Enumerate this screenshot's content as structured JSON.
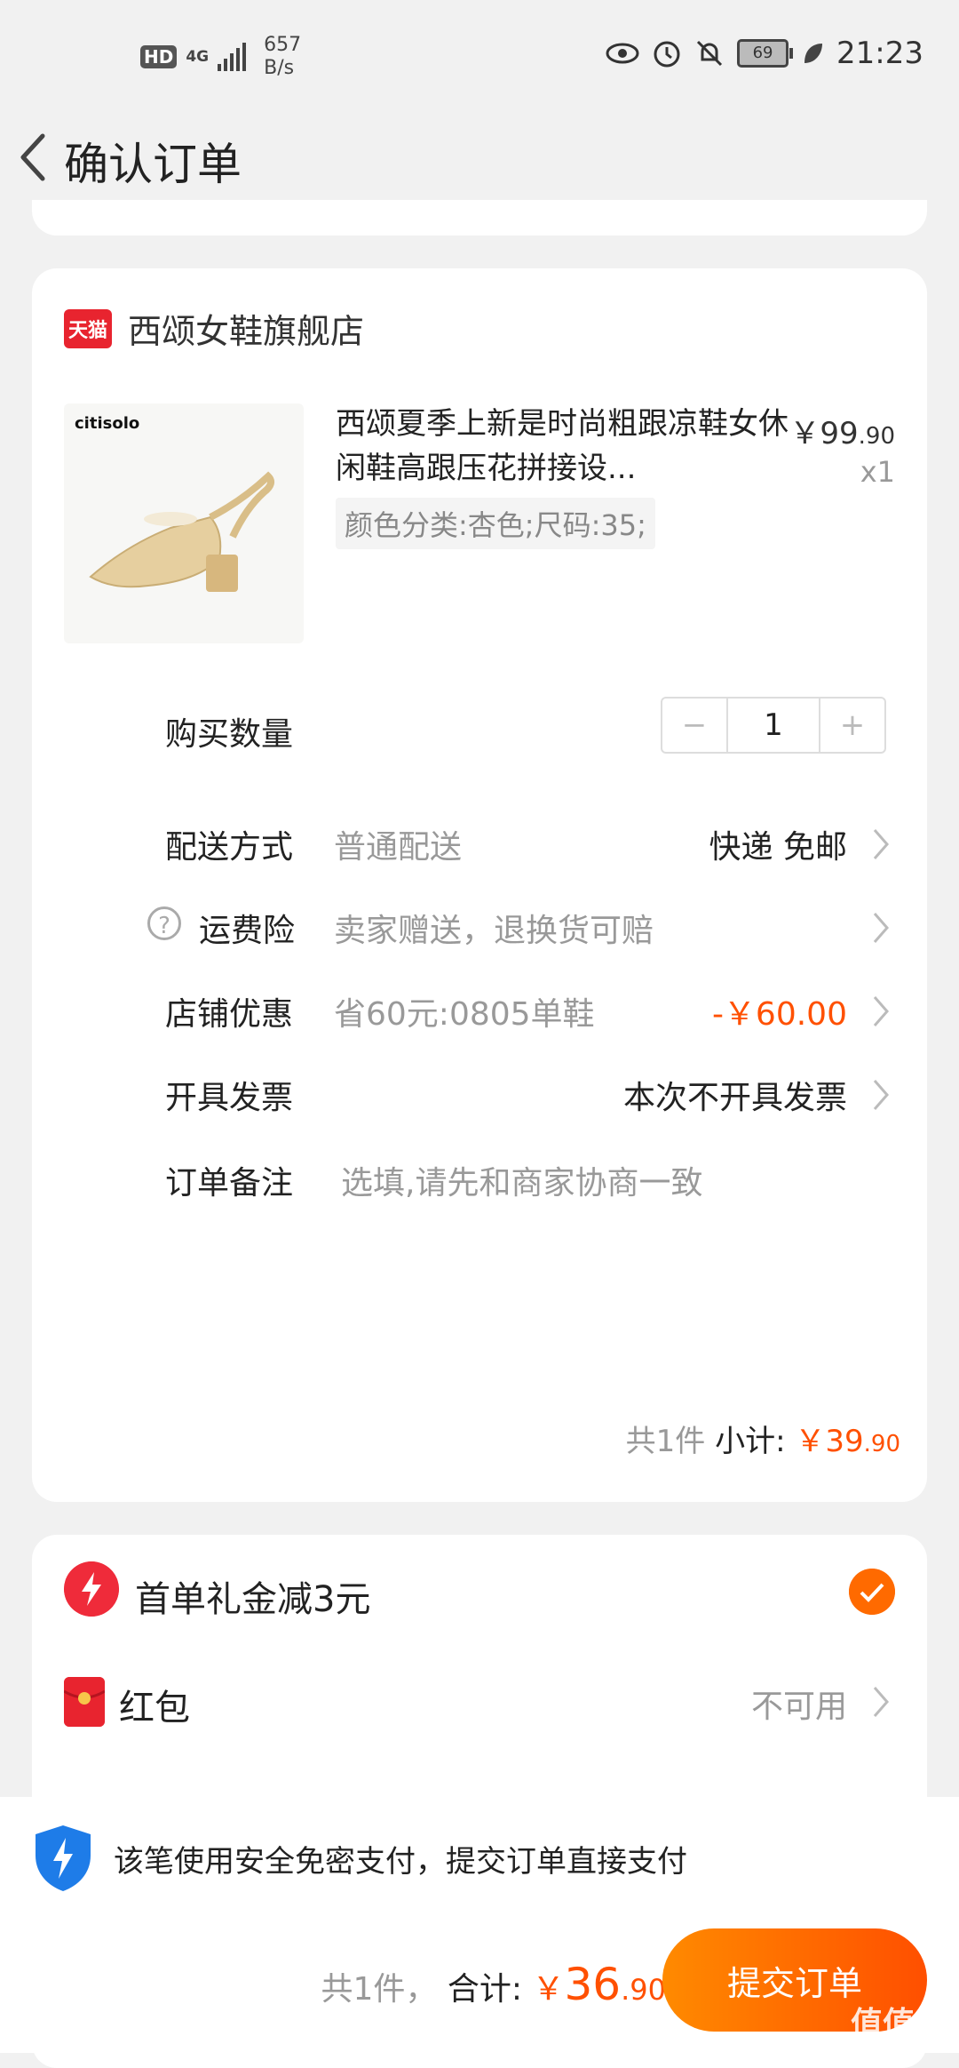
{
  "status_bar": {
    "hd": "HD",
    "network": "4G",
    "speed_value": "657",
    "speed_unit": "B/s",
    "battery": "69",
    "time": "21:23"
  },
  "header": {
    "title": "确认订单"
  },
  "store": {
    "badge": "天猫",
    "name": "西颂女鞋旗舰店",
    "product": {
      "image_brand": "citisolo",
      "title": "西颂夏季上新是时尚粗跟凉鞋女休闲鞋高跟压花拼接设...",
      "sku": "颜色分类:杏色;尺码:35;",
      "price_main": "￥99",
      "price_cents": ".90",
      "quantity": "x1"
    },
    "quantity_row": {
      "label": "购买数量",
      "minus": "−",
      "value": "1",
      "plus": "+"
    },
    "delivery": {
      "label": "配送方式",
      "value": "普通配送",
      "right": "快递 免邮"
    },
    "insurance": {
      "icon": "?",
      "label": "运费险",
      "value": "卖家赠送，退换货可赔"
    },
    "discount": {
      "label": "店铺优惠",
      "value": "省60元:0805单鞋",
      "right": "-￥60.00"
    },
    "invoice": {
      "label": "开具发票",
      "right": "本次不开具发票"
    },
    "note": {
      "label": "订单备注",
      "placeholder": "选填,请先和商家协商一致"
    },
    "subtotal": {
      "count": "共1件",
      "label": "小计:",
      "amount_main": "￥39",
      "amount_cents": ".90"
    }
  },
  "promos": {
    "first_order": {
      "label": "首单礼金减3元"
    },
    "red_packet": {
      "label": "红包",
      "right": "不可用"
    }
  },
  "bottom": {
    "notice": "该笔使用安全免密支付，提交订单直接支付",
    "count": "共1件，",
    "total_label": "合计:",
    "currency": "￥",
    "total_main": "36",
    "total_cents": ".90",
    "submit": "提交订单",
    "watermark": "值值值"
  },
  "colors": {
    "accent": "#ff5000",
    "tmall_red": "#e8242f",
    "background": "#f1f1f1"
  }
}
